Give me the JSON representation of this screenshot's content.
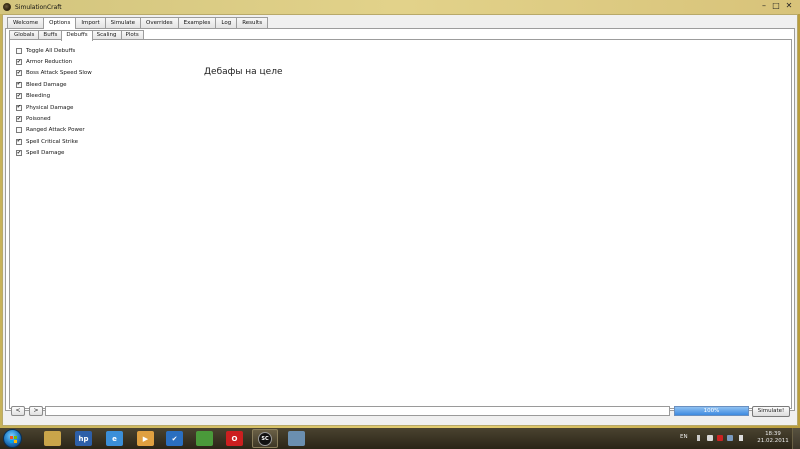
{
  "window": {
    "title": "SimulationCraft",
    "subtitle": "",
    "controls": {
      "minimize": "–",
      "maximize": "□",
      "close": "✕"
    }
  },
  "tabs": [
    "Welcome",
    "Options",
    "Import",
    "Simulate",
    "Overrides",
    "Examples",
    "Log",
    "Results"
  ],
  "active_tab": "Options",
  "subtabs": [
    "Globals",
    "Buffs",
    "Debuffs",
    "Scaling",
    "Plots"
  ],
  "active_subtab": "Debuffs",
  "debuffs": [
    {
      "label": "Toggle All Debuffs",
      "checked": false
    },
    {
      "label": "Armor Reduction",
      "checked": true
    },
    {
      "label": "Boss Attack Speed Slow",
      "checked": true
    },
    {
      "label": "Bleed Damage",
      "checked": true
    },
    {
      "label": "Bleeding",
      "checked": true
    },
    {
      "label": "Physical Damage",
      "checked": true
    },
    {
      "label": "Poisoned",
      "checked": true
    },
    {
      "label": "Ranged Attack Power",
      "checked": false
    },
    {
      "label": "Spell Critical Strike",
      "checked": true
    },
    {
      "label": "Spell Damage",
      "checked": true
    }
  ],
  "overlay_text": "Дебафы на целе",
  "bottom": {
    "back_label": "<",
    "forward_label": ">",
    "progress_text": "100%",
    "progress_value": 1.0,
    "simulate_label": "Simulate!"
  },
  "taskbar": {
    "apps": [
      {
        "name": "explorer-icon",
        "glyph": ""
      },
      {
        "name": "hp-icon",
        "glyph": "hp"
      },
      {
        "name": "internet-explorer-icon",
        "glyph": "e"
      },
      {
        "name": "media-player-icon",
        "glyph": "▶"
      },
      {
        "name": "checkmark-app-icon",
        "glyph": "✔"
      },
      {
        "name": "cash-app-icon",
        "glyph": ""
      },
      {
        "name": "opera-icon",
        "glyph": "O"
      },
      {
        "name": "simulationcraft-icon",
        "glyph": "SC"
      },
      {
        "name": "settings-app-icon",
        "glyph": ""
      }
    ],
    "language": "EN",
    "time": "18:39",
    "date": "21.02.2011"
  },
  "colors": {
    "progress_fill": "#3d8ae0",
    "desktop_accent": "#d9c46b",
    "taskbar": "#2b2517"
  }
}
